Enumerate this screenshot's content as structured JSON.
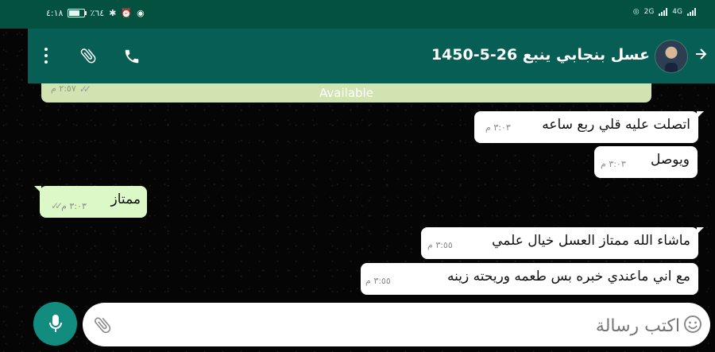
{
  "status_bar": {
    "time": "٤:١٨",
    "battery_percent_text": "٪٦٤",
    "battery_level": 0.64,
    "network_left": "2G",
    "network_right": "4G"
  },
  "header": {
    "title": "عسل بنجابي ينبع 26-5-1450",
    "avatar": "contact-photo"
  },
  "previous_bubble": {
    "text": "Available",
    "time": "٢:٥٧ م"
  },
  "messages": [
    {
      "direction": "incoming",
      "text": "اتصلت عليه قلي ربع ساعه",
      "time": "٣:٠٣ م"
    },
    {
      "direction": "incoming",
      "text": "ويوصل",
      "time": "٣:٠٣ م"
    },
    {
      "direction": "outgoing",
      "text": "ممتاز",
      "time": "٣:٠٣ م",
      "status": "read"
    },
    {
      "direction": "incoming",
      "text": "ماشاء الله ممتاز العسل خيال علمي",
      "time": "٣:٥٥ م"
    },
    {
      "direction": "incoming",
      "text": "مع اني ماعندي خبره بس طعمه وريحته زينه",
      "time": "٣:٥٥ م"
    }
  ],
  "composer": {
    "placeholder": "اكتب رسالة",
    "icons": [
      "attach-icon",
      "emoji-icon",
      "mic-icon"
    ]
  },
  "colors": {
    "header": "#075e54",
    "status_bar": "#04513f",
    "incoming_bubble": "#ffffff",
    "outgoing_bubble": "#dcf8c6",
    "mic_button": "#128c7e"
  }
}
